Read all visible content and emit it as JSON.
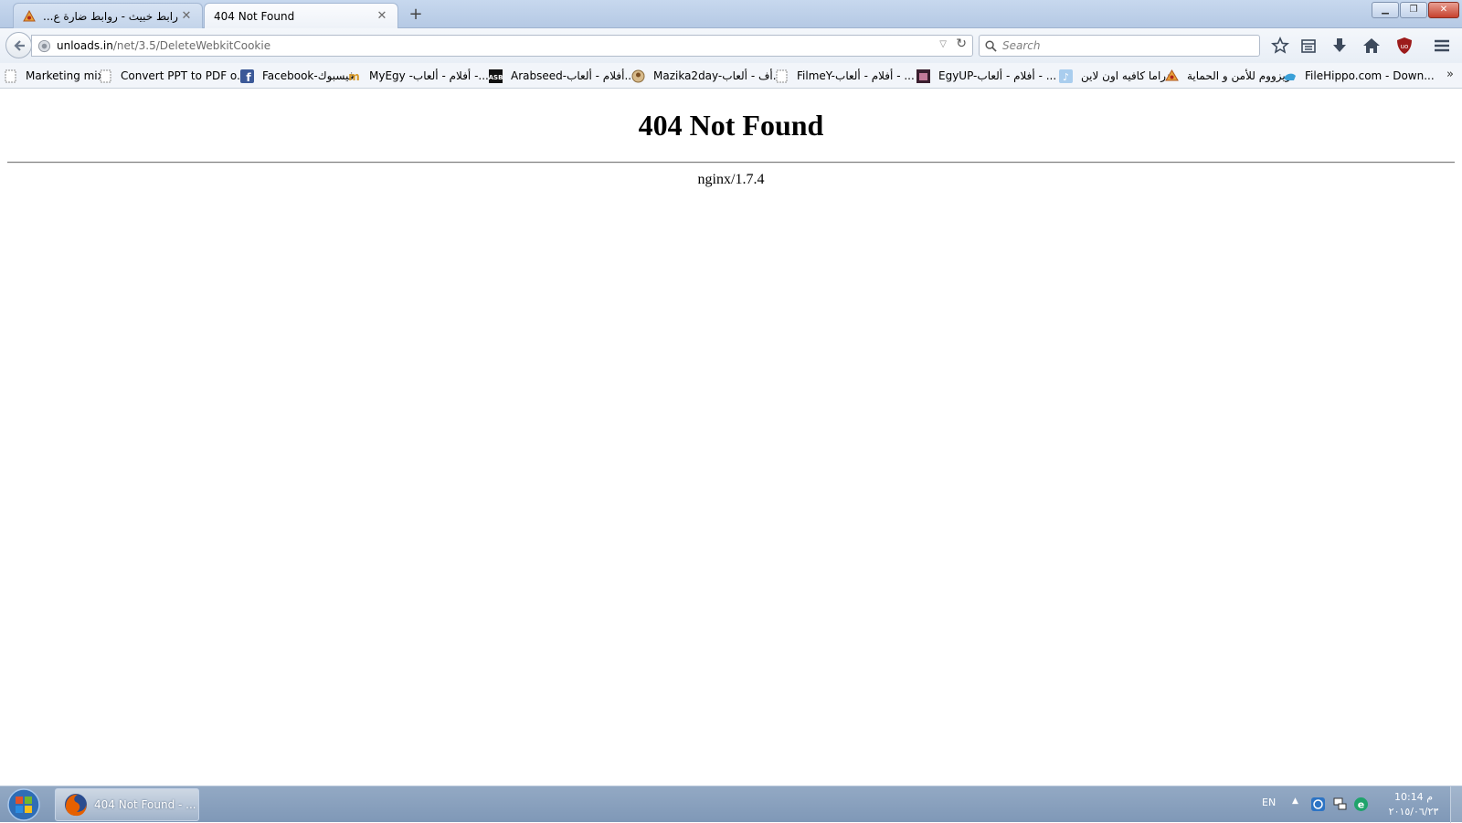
{
  "tabs": [
    {
      "title": "رابط خبيث - روابط ضارة ع...",
      "icon": "site-favicon-orange",
      "active": false
    },
    {
      "title": "404 Not Found",
      "icon": "",
      "active": true
    }
  ],
  "toolbar": {
    "url_domain": "unloads.in",
    "url_path": "/net/3.5/DeleteWebkitCookie",
    "search_placeholder": "Search"
  },
  "bookmarks": [
    {
      "label": "Marketing mix",
      "icon": "blank-page-icon"
    },
    {
      "label": "Convert PPT to PDF o...",
      "icon": "blank-page-icon"
    },
    {
      "label": "Facebook-فيسبوك",
      "icon": "facebook-icon"
    },
    {
      "label": "MyEgy -أفلام - ألعاب -...",
      "icon": "myegy-icon"
    },
    {
      "label": "Arabseed-أفلام - ألعاب...",
      "icon": "arabseed-icon"
    },
    {
      "label": "Mazika2day-أف - ألعاب...",
      "icon": "mazika-icon"
    },
    {
      "label": "FilmeY-أفلام - ألعاب - ...",
      "icon": "blank-page-icon"
    },
    {
      "label": "EgyUP-أفلام - ألعاب - ...",
      "icon": "egyup-icon"
    },
    {
      "label": "دراما كافيه اون لاين",
      "icon": "music-note-icon"
    },
    {
      "label": "زيزووم للأمن و الحماية",
      "icon": "zizoom-icon"
    },
    {
      "label": "FileHippo.com - Down...",
      "icon": "filehippo-icon"
    }
  ],
  "page": {
    "heading": "404 Not Found",
    "server": "nginx/1.7.4"
  },
  "taskbar": {
    "item_label": "404 Not Found - ...",
    "language": "EN",
    "time": "10:14 م",
    "date": "٢٠١٥/٠٦/٢٣"
  },
  "colors": {
    "tabstrip": "#c7d8ee",
    "taskbar": "#8aa1be",
    "close_button": "#c7412e"
  }
}
